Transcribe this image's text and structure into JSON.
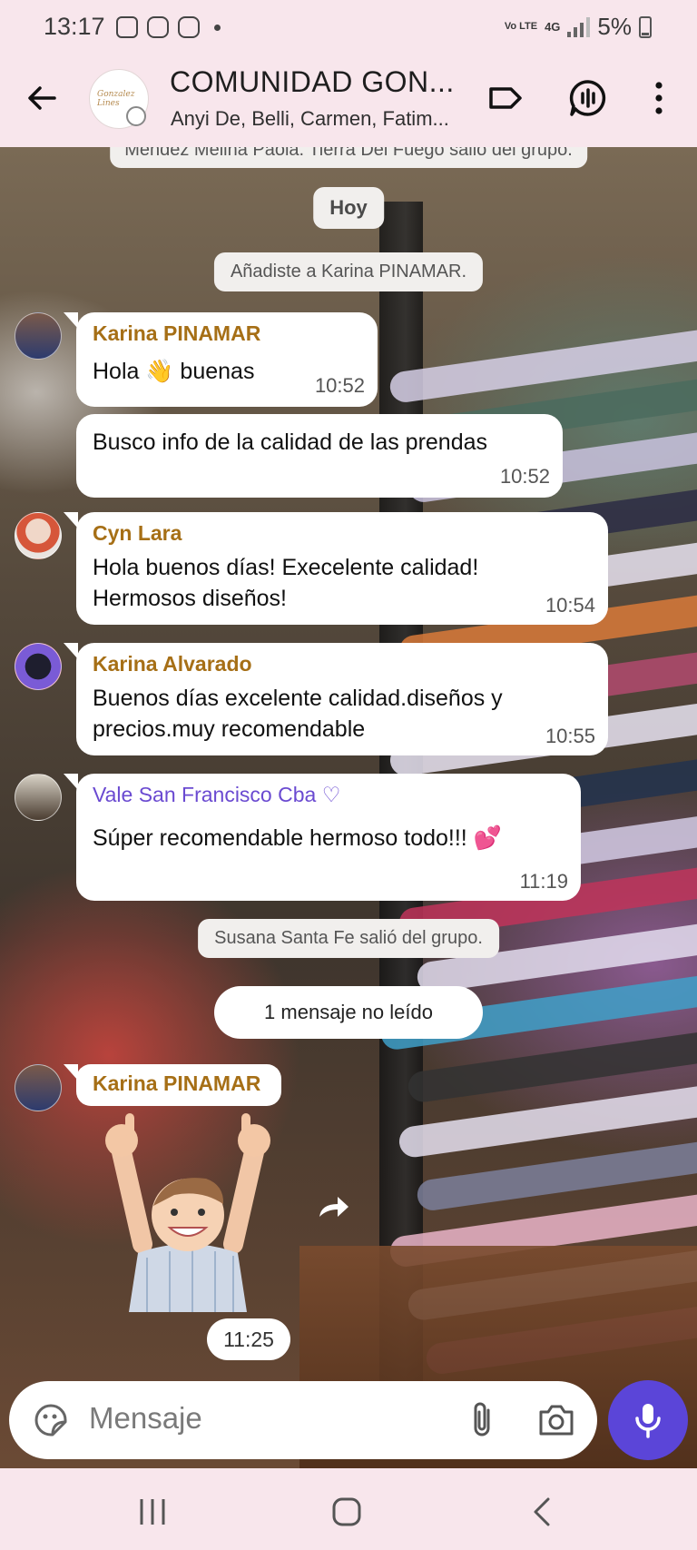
{
  "status_bar": {
    "time": "13:17",
    "network": "4G",
    "volte": "Vo LTE",
    "battery": "5%"
  },
  "header": {
    "title": "COMUNIDAD GON...",
    "subtitle": "Anyi De, Belli, Carmen, Fatim..."
  },
  "chat": {
    "system_top": "Mendez Melina Paola. Tierra Del Fuego salió del grupo.",
    "day_separator": "Hoy",
    "added_notice": "Añadiste a Karina PINAMAR.",
    "messages": [
      {
        "sender": "Karina PINAMAR",
        "sender_color": "#a66f16",
        "text": "Hola 👋 buenas",
        "time": "10:52"
      },
      {
        "sender": "",
        "text": "Busco info de la calidad de las prendas",
        "time": "10:52"
      },
      {
        "sender": "Cyn Lara",
        "sender_color": "#a66f16",
        "line1": "Hola buenos días! Execelente calidad!",
        "line2": "Hermosos diseños!",
        "time": "10:54"
      },
      {
        "sender": "Karina Alvarado",
        "sender_color": "#a66f16",
        "line1": "Buenos días excelente  calidad.diseños y",
        "line2": "precios.muy recomendable",
        "time": "10:55"
      },
      {
        "sender": "Vale San Francisco Cba ♡",
        "sender_color": "#6a4ad1",
        "text": "Súper recomendable hermoso todo!!! 💕",
        "time": "11:19"
      }
    ],
    "left_notice": "Susana Santa Fe salió del grupo.",
    "unread_label": "1 mensaje no leído",
    "sticker_message": {
      "sender": "Karina PINAMAR",
      "time": "11:25"
    }
  },
  "composer": {
    "placeholder": "Mensaje"
  },
  "colors": {
    "accent": "#5b45d8",
    "header_bg": "#f8e6ec",
    "bubble": "#ffffff"
  }
}
